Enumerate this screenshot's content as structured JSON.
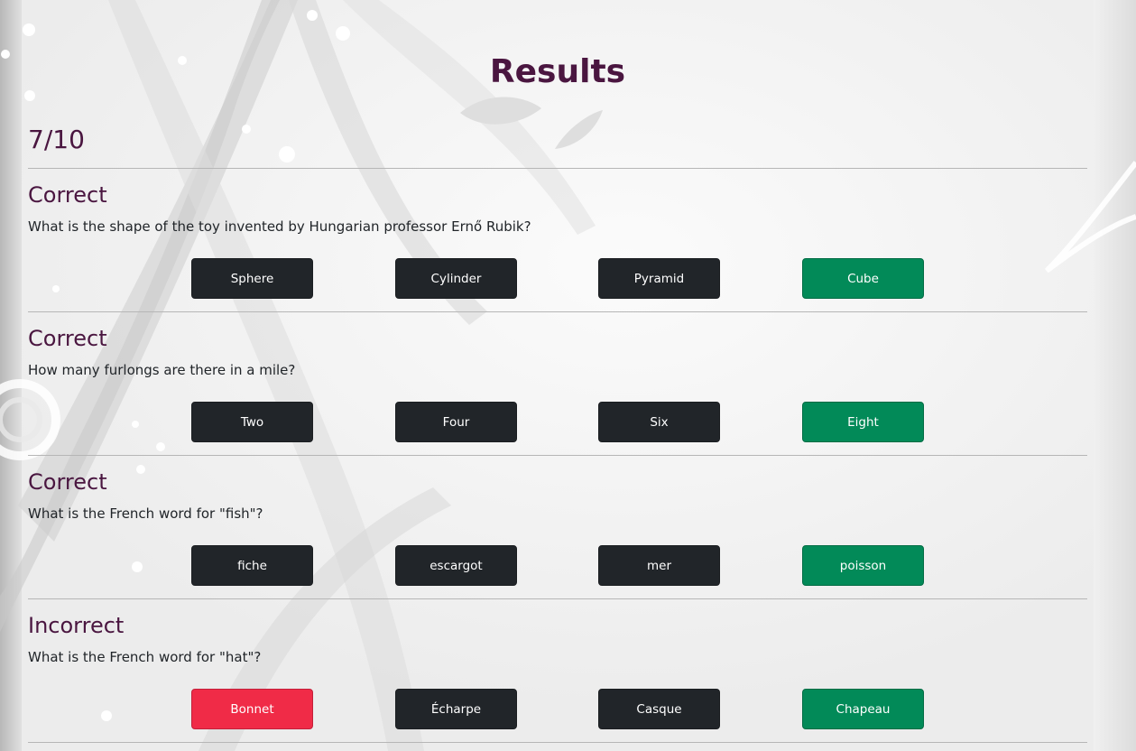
{
  "page": {
    "title": "Results",
    "score": "7/10"
  },
  "colors": {
    "heading": "#4a1640",
    "correct_answer": "#028a58",
    "wrong_answer": "#f02b47",
    "default_answer": "#212529"
  },
  "questions": [
    {
      "status": "Correct",
      "text": "What is the shape of the toy invented by Hungarian professor Ernő Rubik?",
      "answers": [
        {
          "label": "Sphere",
          "state": "default"
        },
        {
          "label": "Cylinder",
          "state": "default"
        },
        {
          "label": "Pyramid",
          "state": "default"
        },
        {
          "label": "Cube",
          "state": "correct"
        }
      ]
    },
    {
      "status": "Correct",
      "text": "How many furlongs are there in a mile?",
      "answers": [
        {
          "label": "Two",
          "state": "default"
        },
        {
          "label": "Four",
          "state": "default"
        },
        {
          "label": "Six",
          "state": "default"
        },
        {
          "label": "Eight",
          "state": "correct"
        }
      ]
    },
    {
      "status": "Correct",
      "text": "What is the French word for \"fish\"?",
      "answers": [
        {
          "label": "fiche",
          "state": "default"
        },
        {
          "label": "escargot",
          "state": "default"
        },
        {
          "label": "mer",
          "state": "default"
        },
        {
          "label": "poisson",
          "state": "correct"
        }
      ]
    },
    {
      "status": "Incorrect",
      "text": "What is the French word for \"hat\"?",
      "answers": [
        {
          "label": "Bonnet",
          "state": "wrong"
        },
        {
          "label": "Écharpe",
          "state": "default"
        },
        {
          "label": "Casque",
          "state": "default"
        },
        {
          "label": "Chapeau",
          "state": "correct"
        }
      ]
    }
  ]
}
